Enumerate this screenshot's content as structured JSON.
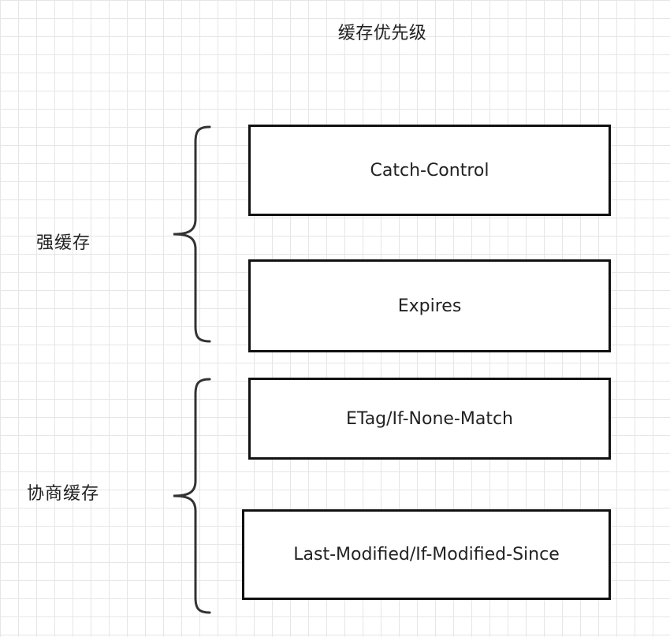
{
  "diagram": {
    "title": "缓存优先级",
    "groups": [
      {
        "label": "强缓存",
        "items": [
          "Catch-Control",
          "Expires"
        ]
      },
      {
        "label": "协商缓存",
        "items": [
          "ETag/If-None-Match",
          "Last-Modified/If-Modified-Since"
        ]
      }
    ]
  },
  "colors": {
    "grid": "#e6e6e6",
    "border": "#111111",
    "text": "#222222",
    "brace": "#333333"
  }
}
